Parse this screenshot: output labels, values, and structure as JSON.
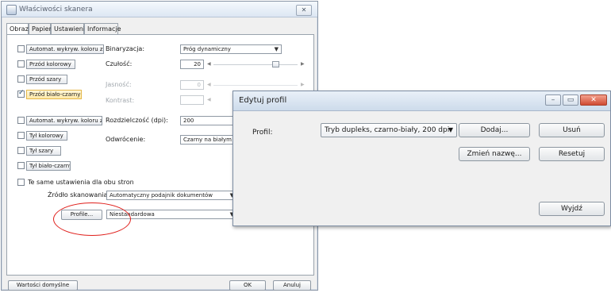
{
  "scanner_window": {
    "title": "Właściwości skanera",
    "close_label": "✕",
    "tabs": [
      "Obraz",
      "Papier",
      "Ustawienie",
      "Informacje"
    ],
    "front_options": [
      {
        "label": "Automat. wykryw. koloru z prz",
        "checked": false
      },
      {
        "label": "Przód kolorowy",
        "checked": false
      },
      {
        "label": "Przód szary",
        "checked": false
      },
      {
        "label": "Przód biało-czarny",
        "checked": true
      }
    ],
    "back_options": [
      {
        "label": "Automat. wykryw. koloru z tyłu",
        "checked": false
      },
      {
        "label": "Tył kolorowy",
        "checked": false
      },
      {
        "label": "Tył szary",
        "checked": false
      },
      {
        "label": "Tył biało-czarny",
        "checked": false
      }
    ],
    "binarization_label": "Binaryzacja:",
    "binarization_value": "Próg dynamiczny",
    "sensitivity_label": "Czułość:",
    "sensitivity_value": "20",
    "brightness_label": "Jasność:",
    "brightness_value": "0",
    "contrast_label": "Kontrast:",
    "resolution_label": "Rozdzielczość (dpi):",
    "resolution_value": "200",
    "invert_label": "Odwrócenie:",
    "invert_value": "Czarny na białym",
    "same_settings_label": "Te same ustawienia dla obu stron",
    "scan_source_label": "Źródło skanowania:",
    "scan_source_value": "Automatyczny podajnik dokumentów",
    "profile_button": "Profile...",
    "profile_value": "Niestandardowa",
    "defaults_button": "Wartości domyślne",
    "ok_button": "OK",
    "cancel_button": "Anuluj"
  },
  "edit_profile_dialog": {
    "title": "Edytuj profil",
    "minimize_label": "–",
    "maximize_label": "▭",
    "close_label": "✕",
    "profile_label": "Profil:",
    "profile_value": "Tryb dupleks, czarno-biały, 200 dpi",
    "add_button": "Dodaj...",
    "delete_button": "Usuń",
    "rename_button": "Zmień nazwę...",
    "reset_button": "Resetuj",
    "exit_button": "Wyjdź"
  },
  "colors": {
    "annotation_circle": "#e0201c",
    "selected_item_border": "#e4b74a",
    "close_button": "#cf4a32"
  }
}
